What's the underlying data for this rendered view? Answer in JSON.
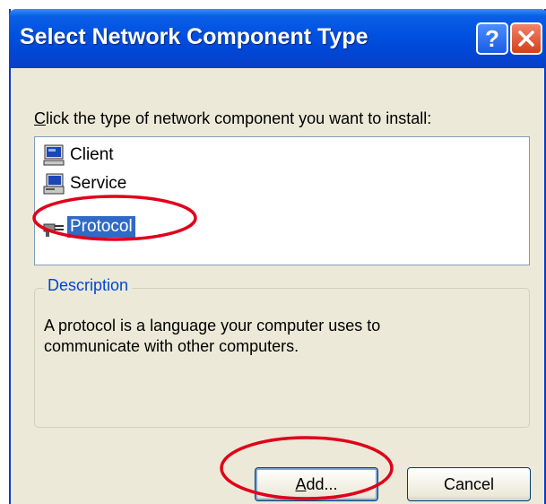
{
  "window": {
    "title": "Select Network Component Type",
    "help_label": "?",
    "help_icon": "question-mark-icon",
    "close_icon": "close-x-icon"
  },
  "prompt": {
    "accel": "C",
    "rest": "lick the type of network component you want to install:"
  },
  "component_list": [
    {
      "label": "Client",
      "icon": "client-computer-icon",
      "selected": false
    },
    {
      "label": "Service",
      "icon": "service-computer-icon",
      "selected": false
    },
    {
      "label": "Protocol",
      "icon": "protocol-plug-icon",
      "selected": true
    }
  ],
  "description": {
    "group_label": "Description",
    "line1": "A protocol is a language your computer uses to",
    "line2": "communicate with other computers."
  },
  "buttons": {
    "add": {
      "accel": "A",
      "rest": "dd..."
    },
    "cancel": {
      "label": "Cancel"
    }
  },
  "annotations": {
    "color": "#e0001a"
  },
  "colors": {
    "titlebar": "#0050e0",
    "dialog_bg": "#ece9d8",
    "selection": "#316ac5",
    "group_label": "#0046d5"
  }
}
